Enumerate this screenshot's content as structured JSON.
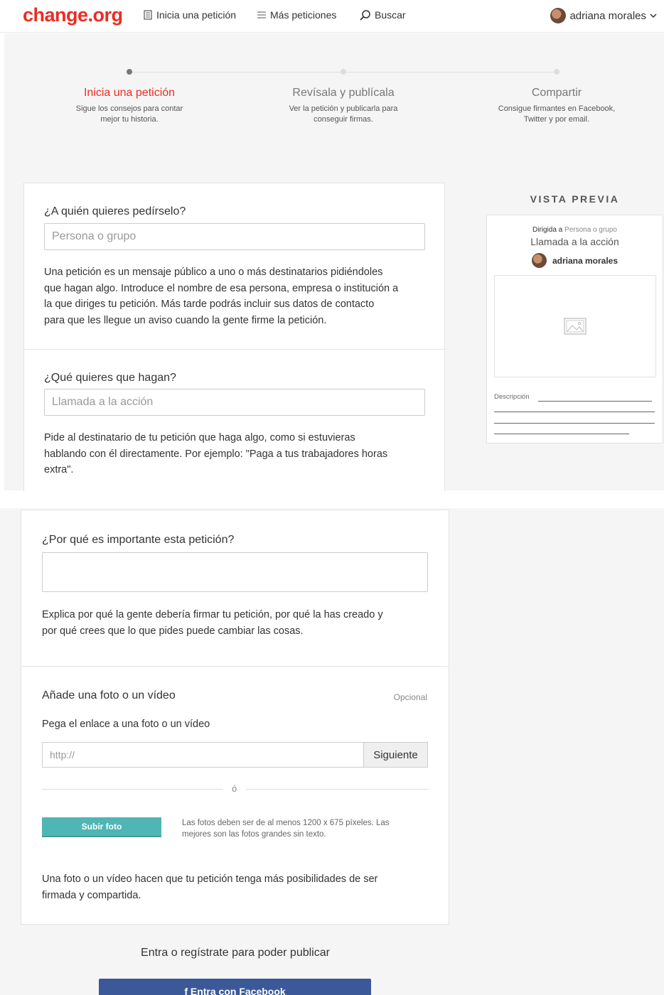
{
  "header": {
    "logo": "change.org",
    "nav": {
      "start_petition": "Inicia una petición",
      "more_petitions": "Más peticiones",
      "search": "Buscar"
    },
    "user_name": "adriana morales"
  },
  "stepper": {
    "steps": [
      {
        "title": "Inicia una petición",
        "desc_line1": "Sigue los consejos para contar",
        "desc_line2": "mejor tu historia."
      },
      {
        "title": "Revísala y publícala",
        "desc_line1": "Ver la petición y publicarla para",
        "desc_line2": "conseguir firmas."
      },
      {
        "title": "Compartir",
        "desc_line1": "Consigue firmantes en Facebook,",
        "desc_line2": "Twitter y por email."
      }
    ]
  },
  "form": {
    "recipient": {
      "title": "¿A quién quieres pedírselo?",
      "placeholder": "Persona o grupo",
      "help_lines": [
        "Una petición es un mensaje público a uno o más destinatarios pidiéndoles",
        "que hagan algo. Introduce el nombre de esa persona, empresa o institución a",
        "la que diriges tu petición. Más tarde podrás incluir sus datos de contacto",
        "para que les llegue un aviso cuando la gente firme la petición."
      ]
    },
    "action": {
      "title": "¿Qué quieres que hagan?",
      "placeholder": "Llamada a la acción",
      "help_lines": [
        "Pide al destinatario de tu petición que haga algo, como si estuvieras",
        "hablando con él directamente. Por ejemplo: \"Paga a tus trabajadores horas",
        "extra\"."
      ]
    },
    "why": {
      "title": "¿Por qué es importante esta petición?",
      "value": "",
      "help_lines": [
        "Explica por qué la gente debería firmar tu petición, por qué la has creado y",
        "por qué crees que lo que pides puede cambiar las cosas."
      ]
    },
    "media": {
      "title": "Añade una foto o un vídeo",
      "optional": "Opcional",
      "link_label": "Pega el enlace a una foto o un vídeo",
      "url_placeholder": "http://",
      "next_button": "Siguiente",
      "or": "ó",
      "upload_button": "Subir foto",
      "upload_note_line1": "Las fotos deben ser de al menos 1200 x 675 píxeles. Las",
      "upload_note_line2": "mejores son las fotos grandes sin texto.",
      "help_lines": [
        "Una foto o un vídeo hacen que tu petición tenga más posibilidades de ser",
        "firmada y compartida."
      ]
    }
  },
  "preview": {
    "label": "VISTA PREVIA",
    "to_prefix": "Dirigida a",
    "to_value": "Persona o grupo",
    "title": "Llamada a la acción",
    "author": "adriana morales",
    "desc_label": "Descripción"
  },
  "cta": {
    "text": "Entra o regístrate para poder publicar",
    "facebook_button": "f  Entra con Facebook"
  },
  "colors": {
    "brand_red": "#ec2c22",
    "teal": "#4fb5b5",
    "facebook_blue": "#3b5998"
  }
}
